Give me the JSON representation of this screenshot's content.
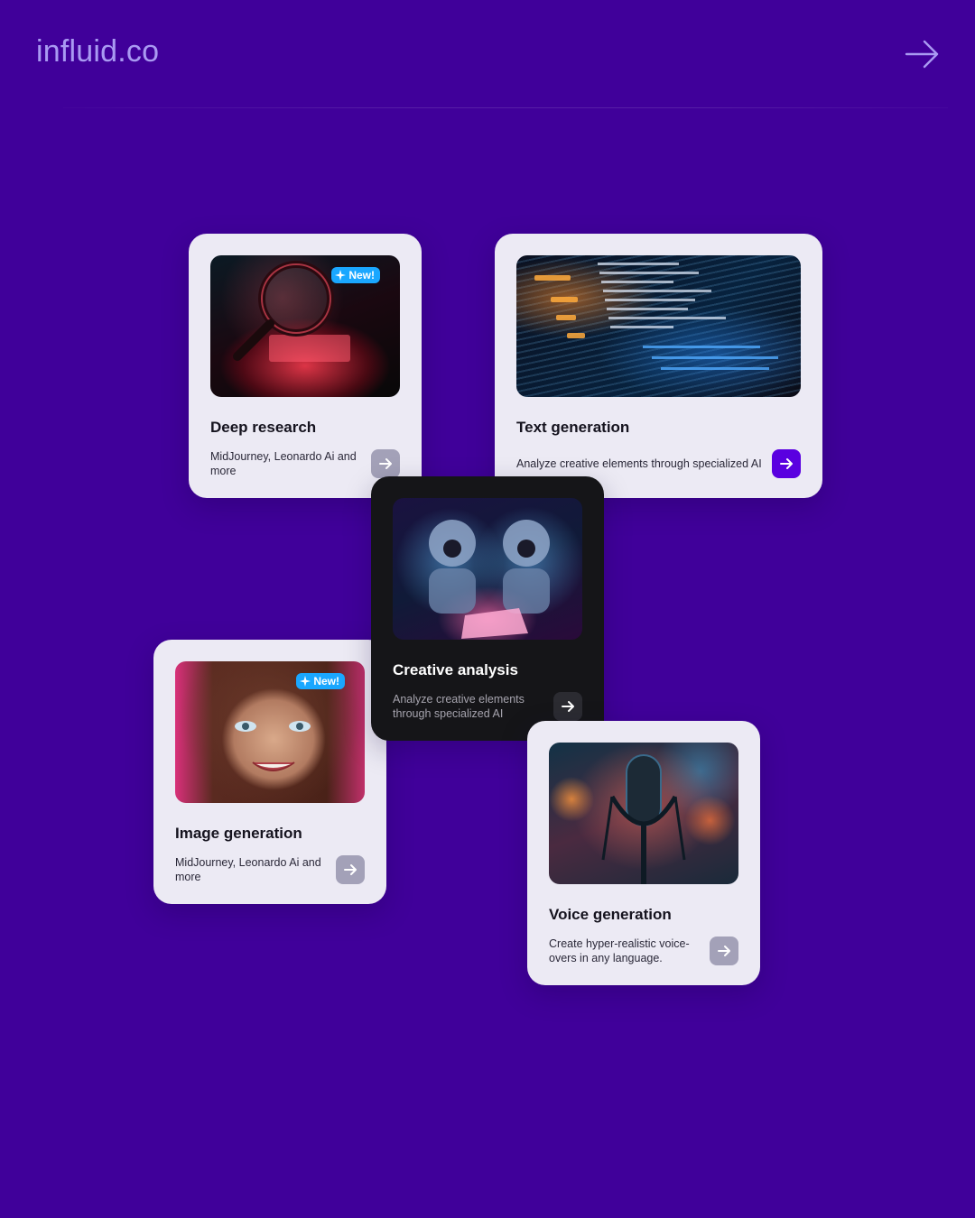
{
  "brand": {
    "name": "influid.co"
  },
  "header": {
    "next_icon": "arrow-right-icon"
  },
  "badge": {
    "label": "New!",
    "icon": "sparkle-icon",
    "color": "#1aa7ff"
  },
  "cards": [
    {
      "title": "Deep research",
      "description": "MidJourney, Leonardo Ai and more",
      "has_badge": true,
      "theme": "light",
      "image": "magnifying-glass-over-book"
    },
    {
      "title": "Text generation",
      "description": "Analyze creative elements through specialized AI",
      "has_badge": false,
      "theme": "light",
      "image": "code-on-screen"
    },
    {
      "title": "Creative analysis",
      "description": "Analyze creative elements through specialized AI",
      "has_badge": false,
      "theme": "dark",
      "image": "robots-reading-document"
    },
    {
      "title": "Image generation",
      "description": "MidJourney, Leonardo Ai and more",
      "has_badge": true,
      "theme": "light",
      "image": "smiling-woman-portrait"
    },
    {
      "title": "Voice generation",
      "description": "Create hyper-realistic voice-overs in any language.",
      "has_badge": false,
      "theme": "light",
      "image": "studio-microphone"
    }
  ],
  "colors": {
    "background": "#40009a",
    "card": "#eceaf4",
    "card_dark": "#151518",
    "accent": "#5a00e0",
    "brand_text": "#a99af2"
  }
}
